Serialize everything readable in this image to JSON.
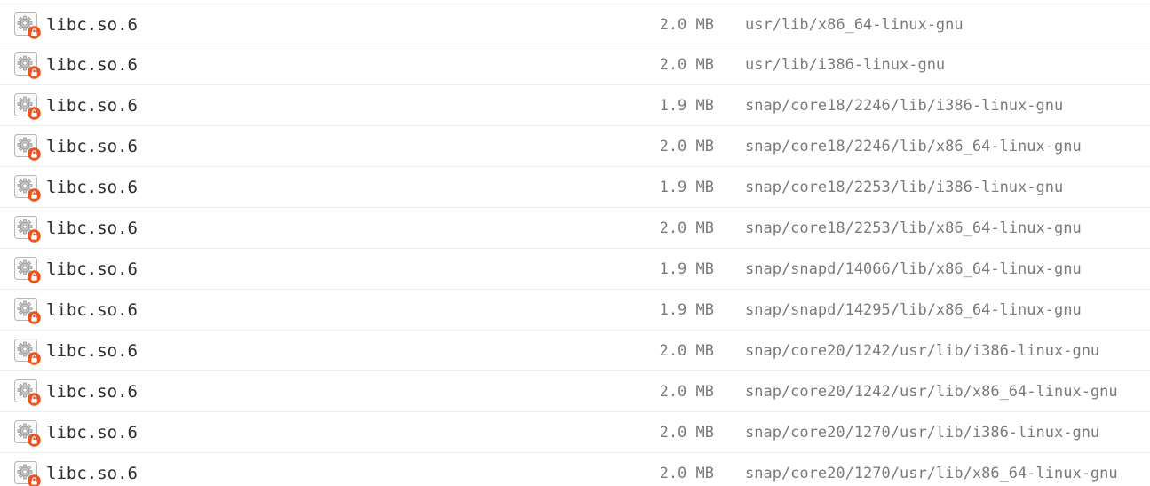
{
  "colors": {
    "lock_badge": "#e95420",
    "file_icon_border": "#b8b8b8",
    "text_primary": "#2e2e2e",
    "text_secondary": "#7a7a7a"
  },
  "files": [
    {
      "name": "libc.so.6",
      "size": "2.0 MB",
      "location": "usr/lib/x86_64-linux-gnu",
      "icon": "shared-library-icon",
      "badge": "lock-icon"
    },
    {
      "name": "libc.so.6",
      "size": "2.0 MB",
      "location": "usr/lib/i386-linux-gnu",
      "icon": "shared-library-icon",
      "badge": "lock-icon"
    },
    {
      "name": "libc.so.6",
      "size": "1.9 MB",
      "location": "snap/core18/2246/lib/i386-linux-gnu",
      "icon": "shared-library-icon",
      "badge": "lock-icon"
    },
    {
      "name": "libc.so.6",
      "size": "2.0 MB",
      "location": "snap/core18/2246/lib/x86_64-linux-gnu",
      "icon": "shared-library-icon",
      "badge": "lock-icon"
    },
    {
      "name": "libc.so.6",
      "size": "1.9 MB",
      "location": "snap/core18/2253/lib/i386-linux-gnu",
      "icon": "shared-library-icon",
      "badge": "lock-icon"
    },
    {
      "name": "libc.so.6",
      "size": "2.0 MB",
      "location": "snap/core18/2253/lib/x86_64-linux-gnu",
      "icon": "shared-library-icon",
      "badge": "lock-icon"
    },
    {
      "name": "libc.so.6",
      "size": "1.9 MB",
      "location": "snap/snapd/14066/lib/x86_64-linux-gnu",
      "icon": "shared-library-icon",
      "badge": "lock-icon"
    },
    {
      "name": "libc.so.6",
      "size": "1.9 MB",
      "location": "snap/snapd/14295/lib/x86_64-linux-gnu",
      "icon": "shared-library-icon",
      "badge": "lock-icon"
    },
    {
      "name": "libc.so.6",
      "size": "2.0 MB",
      "location": "snap/core20/1242/usr/lib/i386-linux-gnu",
      "icon": "shared-library-icon",
      "badge": "lock-icon"
    },
    {
      "name": "libc.so.6",
      "size": "2.0 MB",
      "location": "snap/core20/1242/usr/lib/x86_64-linux-gnu",
      "icon": "shared-library-icon",
      "badge": "lock-icon"
    },
    {
      "name": "libc.so.6",
      "size": "2.0 MB",
      "location": "snap/core20/1270/usr/lib/i386-linux-gnu",
      "icon": "shared-library-icon",
      "badge": "lock-icon"
    },
    {
      "name": "libc.so.6",
      "size": "2.0 MB",
      "location": "snap/core20/1270/usr/lib/x86_64-linux-gnu",
      "icon": "shared-library-icon",
      "badge": "lock-icon"
    }
  ]
}
